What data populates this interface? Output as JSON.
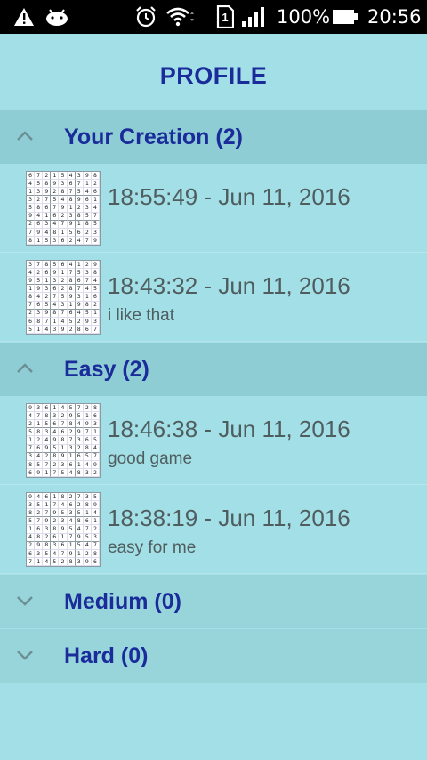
{
  "status_bar": {
    "battery": "100%",
    "time": "20:56",
    "sim_label": "1"
  },
  "title": "PROFILE",
  "groups": [
    {
      "label": "Your Creation (2)",
      "expanded": true,
      "items": [
        {
          "timestamp": "18:55:49 - Jun 11, 2016",
          "comment": "",
          "grid": [
            "672154398",
            "458936712",
            "139287546",
            "327548961",
            "586791234",
            "941623857",
            "263479185",
            "794815623",
            "815362479"
          ]
        },
        {
          "timestamp": "18:43:32 - Jun 11, 2016",
          "comment": "i like that",
          "grid": [
            "378564129",
            "426917538",
            "951328674",
            "193628745",
            "842759316",
            "765431982",
            "239876451",
            "687145293",
            "514392867"
          ]
        }
      ]
    },
    {
      "label": "Easy (2)",
      "expanded": true,
      "items": [
        {
          "timestamp": "18:46:38 - Jun 11, 2016",
          "comment": "good game",
          "grid": [
            "936145728",
            "478329516",
            "215678493",
            "583462971",
            "124987365",
            "769513284",
            "342891657",
            "857236149",
            "691754832"
          ]
        },
        {
          "timestamp": "18:38:19 - Jun 11, 2016",
          "comment": "easy for me",
          "grid": [
            "946182735",
            "351746289",
            "827953514",
            "579234861",
            "163895472",
            "482617953",
            "298361547",
            "635479128",
            "714528396"
          ]
        }
      ]
    },
    {
      "label": "Medium (0)",
      "expanded": false,
      "items": []
    },
    {
      "label": "Hard (0)",
      "expanded": false,
      "items": []
    }
  ],
  "colors": {
    "background": "#a2dfe6",
    "header_bg": "#8fcdd4",
    "title": "#1a2b9a",
    "text": "#4f5d5f"
  }
}
